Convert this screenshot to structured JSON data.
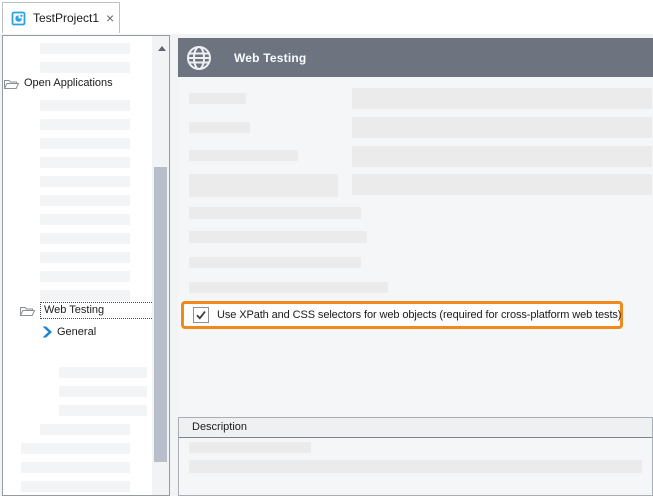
{
  "tab_bar": {
    "tabs": [
      {
        "label": "TestProject1",
        "close_label": "×",
        "active": true
      }
    ]
  },
  "sidebar": {
    "items": [
      {
        "label": "Open Applications",
        "icon": "open-folder-icon",
        "level": 0,
        "selected": false
      },
      {
        "label": "Web Testing",
        "icon": "open-folder-icon",
        "level": 1,
        "selected": true
      },
      {
        "label": "General",
        "icon": "blue-arrow-icon",
        "level": 2,
        "selected": false
      }
    ]
  },
  "main": {
    "header": {
      "title": "Web Testing",
      "icon": "globe-icon"
    },
    "xpath_option": {
      "checked": true,
      "label": "Use XPath and CSS selectors for web objects (required for cross-platform web tests)"
    },
    "description_panel": {
      "title": "Description"
    }
  },
  "colors": {
    "highlight_orange": "#F08A1D",
    "header_gray": "#6E747F",
    "arrow_blue": "#1D87D2",
    "tab_icon_blue": "#2BA3DC",
    "scrollbar_thumb": "#B9BFCA"
  },
  "placeholders": {
    "sidebar_bars": [
      [
        37,
        7,
        90,
        11
      ],
      [
        37,
        26,
        90,
        11
      ],
      [
        37,
        64,
        90,
        11
      ],
      [
        37,
        83,
        90,
        11
      ],
      [
        37,
        102,
        90,
        11
      ],
      [
        37,
        121,
        90,
        11
      ],
      [
        37,
        140,
        90,
        11
      ],
      [
        37,
        159,
        90,
        11
      ],
      [
        37,
        178,
        90,
        11
      ],
      [
        37,
        197,
        90,
        11
      ],
      [
        37,
        216,
        90,
        11
      ],
      [
        37,
        235,
        90,
        11
      ],
      [
        37,
        254,
        90,
        11
      ],
      [
        56,
        331,
        88,
        11
      ],
      [
        56,
        350,
        88,
        11
      ],
      [
        56,
        369,
        88,
        11
      ],
      [
        37,
        388,
        90,
        11
      ],
      [
        18,
        407,
        109,
        11
      ],
      [
        18,
        426,
        109,
        11
      ],
      [
        18,
        445,
        109,
        11
      ]
    ],
    "main_bars": [
      [
        11,
        55,
        57,
        11
      ],
      [
        174,
        50,
        300,
        21
      ],
      [
        11,
        84,
        61,
        11
      ],
      [
        174,
        79,
        300,
        21
      ],
      [
        11,
        112,
        109,
        11
      ],
      [
        174,
        108,
        300,
        21
      ],
      [
        11,
        136,
        149,
        23
      ],
      [
        174,
        136,
        300,
        21
      ],
      [
        11,
        169,
        172,
        12
      ],
      [
        11,
        193,
        178,
        12
      ],
      [
        11,
        219,
        172,
        11
      ],
      [
        11,
        244,
        199,
        11
      ]
    ],
    "description_bars": [
      [
        10,
        4,
        122,
        11
      ],
      [
        10,
        22,
        453,
        13
      ]
    ]
  }
}
